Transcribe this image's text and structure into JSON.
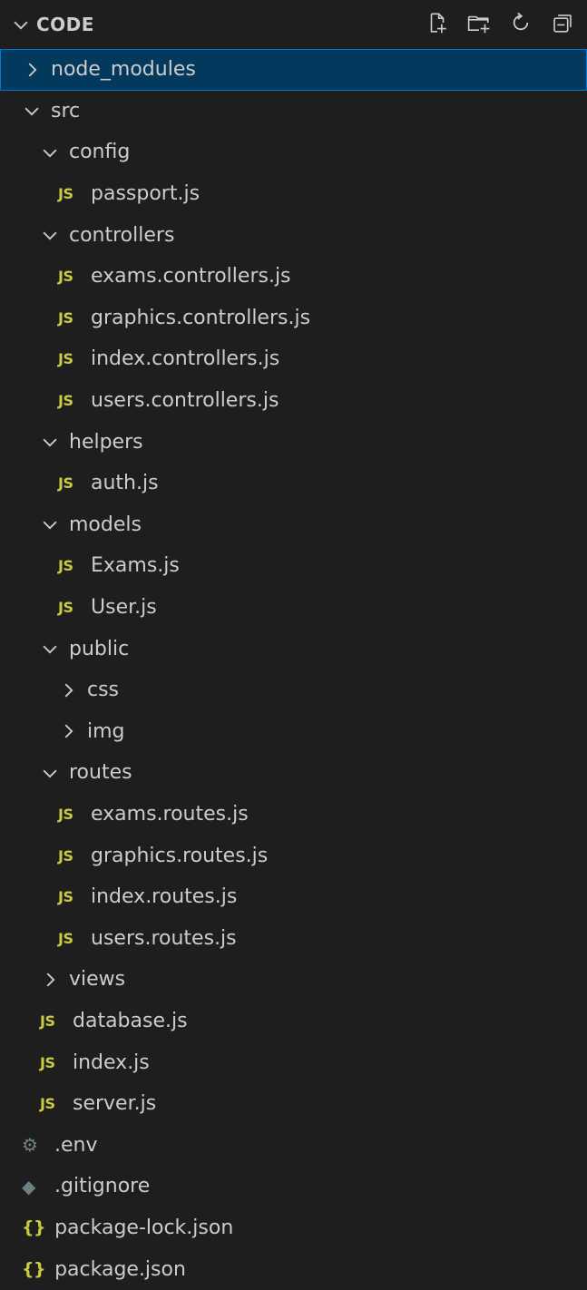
{
  "explorer": {
    "section_title": "CODE",
    "actions": [
      {
        "name": "new-file-icon",
        "title": "New File"
      },
      {
        "name": "new-folder-icon",
        "title": "New Folder"
      },
      {
        "name": "refresh-icon",
        "title": "Refresh Explorer"
      },
      {
        "name": "collapse-all-icon",
        "title": "Collapse Folders in Explorer"
      }
    ],
    "tree": [
      {
        "label": "node_modules",
        "type": "folder",
        "expanded": false,
        "depth": 0,
        "selected": true
      },
      {
        "label": "src",
        "type": "folder",
        "expanded": true,
        "depth": 0
      },
      {
        "label": "config",
        "type": "folder",
        "expanded": true,
        "depth": 1
      },
      {
        "label": "passport.js",
        "type": "js",
        "depth": 2
      },
      {
        "label": "controllers",
        "type": "folder",
        "expanded": true,
        "depth": 1
      },
      {
        "label": "exams.controllers.js",
        "type": "js",
        "depth": 2
      },
      {
        "label": "graphics.controllers.js",
        "type": "js",
        "depth": 2
      },
      {
        "label": "index.controllers.js",
        "type": "js",
        "depth": 2
      },
      {
        "label": "users.controllers.js",
        "type": "js",
        "depth": 2
      },
      {
        "label": "helpers",
        "type": "folder",
        "expanded": true,
        "depth": 1
      },
      {
        "label": "auth.js",
        "type": "js",
        "depth": 2
      },
      {
        "label": "models",
        "type": "folder",
        "expanded": true,
        "depth": 1
      },
      {
        "label": "Exams.js",
        "type": "js",
        "depth": 2
      },
      {
        "label": "User.js",
        "type": "js",
        "depth": 2
      },
      {
        "label": "public",
        "type": "folder",
        "expanded": true,
        "depth": 1
      },
      {
        "label": "css",
        "type": "folder",
        "expanded": false,
        "depth": 2
      },
      {
        "label": "img",
        "type": "folder",
        "expanded": false,
        "depth": 2
      },
      {
        "label": "routes",
        "type": "folder",
        "expanded": true,
        "depth": 1
      },
      {
        "label": "exams.routes.js",
        "type": "js",
        "depth": 2
      },
      {
        "label": "graphics.routes.js",
        "type": "js",
        "depth": 2
      },
      {
        "label": "index.routes.js",
        "type": "js",
        "depth": 2
      },
      {
        "label": "users.routes.js",
        "type": "js",
        "depth": 2
      },
      {
        "label": "views",
        "type": "folder",
        "expanded": false,
        "depth": 1
      },
      {
        "label": "database.js",
        "type": "js",
        "depth": 1
      },
      {
        "label": "index.js",
        "type": "js",
        "depth": 1
      },
      {
        "label": "server.js",
        "type": "js",
        "depth": 1
      },
      {
        "label": ".env",
        "type": "env",
        "depth": 0
      },
      {
        "label": ".gitignore",
        "type": "git",
        "depth": 0
      },
      {
        "label": "package-lock.json",
        "type": "json",
        "depth": 0
      },
      {
        "label": "package.json",
        "type": "json",
        "depth": 0
      }
    ],
    "icons": {
      "js": "JS",
      "json": "{}",
      "env": "⚙",
      "git": "◆"
    },
    "colors": {
      "background": "#1e1e1e",
      "selected_row": "#04395e",
      "selected_border": "#0078d4",
      "js_icon": "#cbcb41",
      "json_icon": "#cbcb41",
      "muted_icon": "#6d8086",
      "text": "#cccccc"
    }
  }
}
